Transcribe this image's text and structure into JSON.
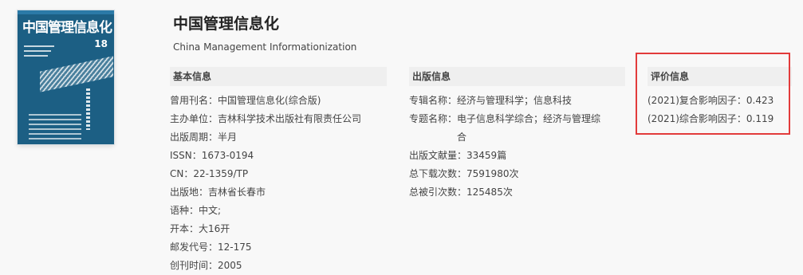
{
  "cover": {
    "title": "中国管理信息化",
    "issue": "18"
  },
  "journal": {
    "title": "中国管理信息化",
    "english_title": "China Management Informationization"
  },
  "basic_info": {
    "header": "基本信息",
    "rows": [
      {
        "label": "曾用刊名：",
        "value": "中国管理信息化(综合版)"
      },
      {
        "label": "主办单位：",
        "value": "吉林科学技术出版社有限责任公司"
      },
      {
        "label": "出版周期：",
        "value": "半月"
      },
      {
        "label": "ISSN：",
        "value": "1673-0194"
      },
      {
        "label": "CN：",
        "value": "22-1359/TP"
      },
      {
        "label": "出版地：",
        "value": "吉林省长春市"
      },
      {
        "label": "语种：",
        "value": "中文;"
      },
      {
        "label": "开本：",
        "value": "大16开"
      },
      {
        "label": "邮发代号：",
        "value": "12-175"
      },
      {
        "label": "创刊时间：",
        "value": "2005"
      }
    ]
  },
  "publish_info": {
    "header": "出版信息",
    "rows": [
      {
        "label": "专辑名称：",
        "value": "经济与管理科学；信息科技"
      },
      {
        "label": "专题名称：",
        "value": "电子信息科学综合；经济与管理综合"
      },
      {
        "label": "出版文献量：",
        "value": "33459篇"
      },
      {
        "label": "总下载次数：",
        "value": "7591980次"
      },
      {
        "label": "总被引次数：",
        "value": "125485次"
      }
    ]
  },
  "evaluation_info": {
    "header": "评价信息",
    "rows": [
      {
        "label": "(2021)复合影响因子：",
        "value": "0.423"
      },
      {
        "label": "(2021)综合影响因子：",
        "value": "0.119"
      }
    ]
  },
  "colors": {
    "cover_blue": "#1c5f84",
    "highlight_red": "#e23b3b",
    "header_gray": "#efefef"
  }
}
